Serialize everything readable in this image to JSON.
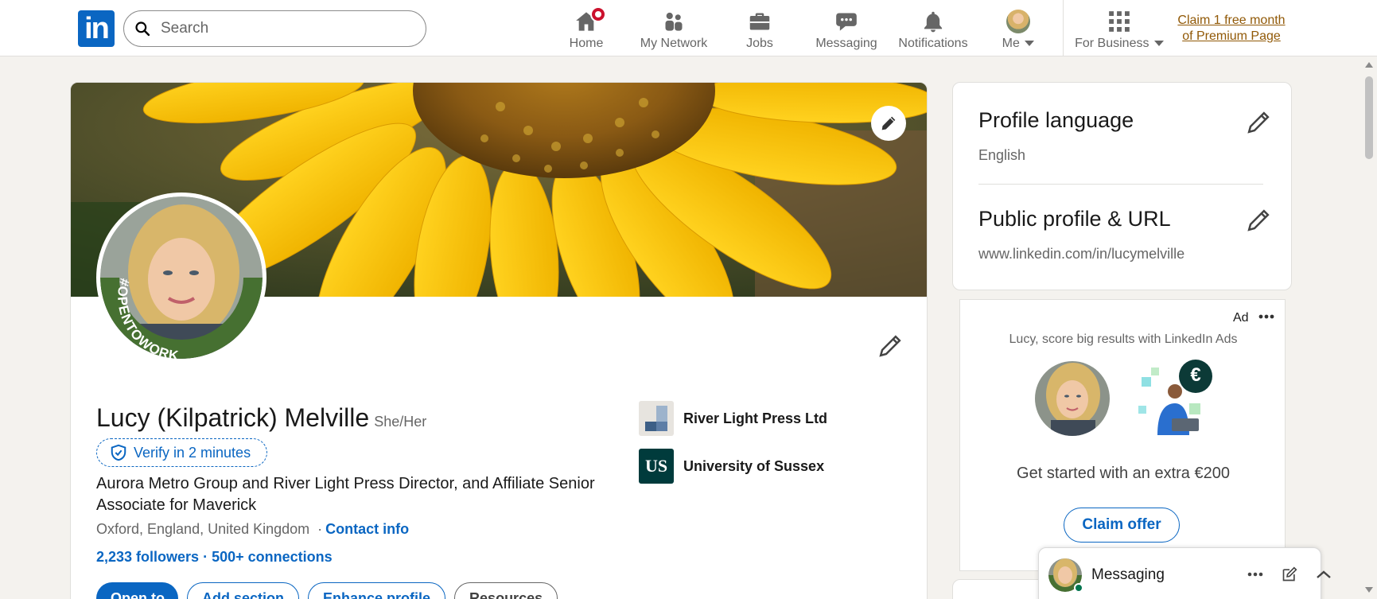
{
  "nav": {
    "logo": "in",
    "search_placeholder": "Search",
    "items": [
      {
        "label": "Home"
      },
      {
        "label": "My Network"
      },
      {
        "label": "Jobs"
      },
      {
        "label": "Messaging"
      },
      {
        "label": "Notifications"
      },
      {
        "label": "Me"
      },
      {
        "label": "For Business"
      }
    ],
    "premium_line1": "Claim 1 free month",
    "premium_line2": "of Premium Page"
  },
  "profile": {
    "name": "Lucy (Kilpatrick) Melville",
    "pronouns": "She/Her",
    "verify_label": "Verify in 2 minutes",
    "headline": "Aurora Metro Group and River Light Press Director, and Affiliate Senior Associate for Maverick",
    "location": "Oxford, England, United Kingdom",
    "location_sep": "·",
    "contact_info": "Contact info",
    "followers": "2,233 followers",
    "stats_sep": " · ",
    "connections": "500+ connections",
    "open_to_badge": "#OPENTOWORK",
    "buttons": {
      "open_to": "Open to",
      "add_section": "Add section",
      "enhance": "Enhance profile",
      "resources": "Resources"
    },
    "orgs": [
      {
        "name": "River Light Press Ltd"
      },
      {
        "name": "University of Sussex",
        "logo_text": "US"
      }
    ]
  },
  "sidebar": {
    "language_title": "Profile language",
    "language_value": "English",
    "url_title": "Public profile & URL",
    "url_value": "www.linkedin.com/in/lucymelville"
  },
  "ad": {
    "label": "Ad",
    "text": "Lucy, score big results with LinkedIn Ads",
    "offer": "Get started with an extra €200",
    "button": "Claim offer",
    "currency_symbol": "€"
  },
  "messaging": {
    "title": "Messaging"
  },
  "colors": {
    "brand_blue": "#0a66c2",
    "premium_gold": "#915907",
    "notification_red": "#cb112d",
    "opentowork_green": "#467031"
  }
}
